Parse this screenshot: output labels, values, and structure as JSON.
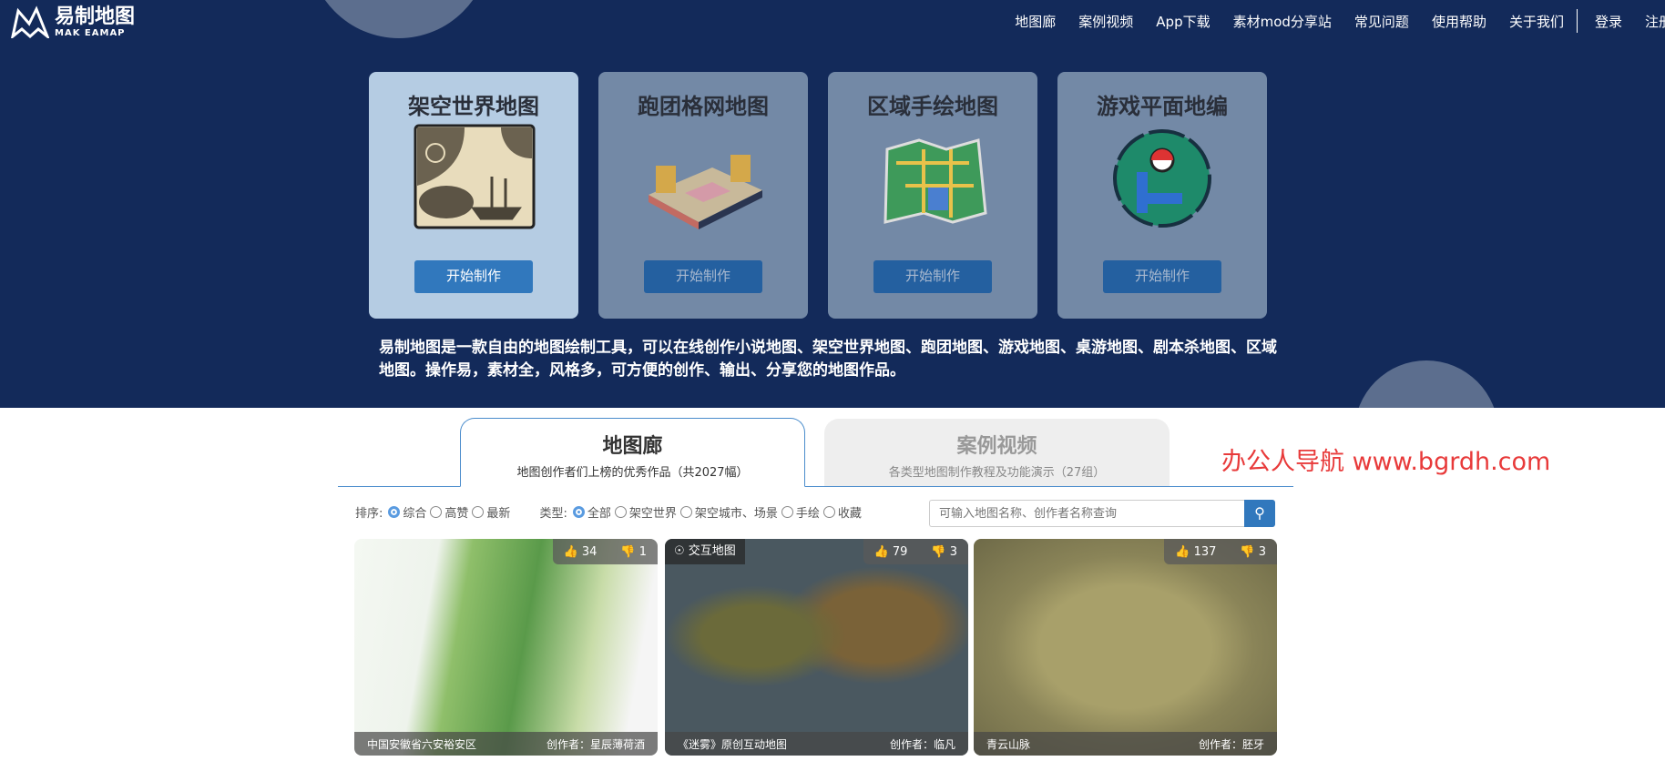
{
  "header": {
    "logo_cn": "易制地图",
    "logo_en": "MAK EAMAP",
    "nav": [
      "地图廊",
      "案例视频",
      "App下载",
      "素材mod分享站",
      "常见问题",
      "使用帮助",
      "关于我们"
    ],
    "login": "登录",
    "register": "注册"
  },
  "cards": [
    {
      "title": "架空世界地图",
      "button": "开始制作"
    },
    {
      "title": "跑团格网地图",
      "button": "开始制作"
    },
    {
      "title": "区域手绘地图",
      "button": "开始制作"
    },
    {
      "title": "游戏平面地编",
      "button": "开始制作"
    }
  ],
  "description": "易制地图是一款自由的地图绘制工具，可以在线创作小说地图、架空世界地图、跑团地图、游戏地图、桌游地图、剧本杀地图、区域地图。操作易，素材全，风格多，可方便的创作、输出、分享您的地图作品。",
  "tabs": [
    {
      "title": "地图廊",
      "subtitle": "地图创作者们上榜的优秀作品（共2027幅）"
    },
    {
      "title": "案例视频",
      "subtitle": "各类型地图制作教程及功能演示（27组）"
    }
  ],
  "watermark": "办公人导航 www.bgrdh.com",
  "filters": {
    "sort_label": "排序:",
    "sort": [
      "综合",
      "高赞",
      "最新"
    ],
    "sort_selected": "综合",
    "type_label": "类型:",
    "types": [
      "全部",
      "架空世界",
      "架空城市、场景",
      "手绘",
      "收藏"
    ],
    "type_selected": "全部"
  },
  "search": {
    "placeholder": "可输入地图名称、创作者名称查询"
  },
  "maps": [
    {
      "name": "中国安徽省六安裕安区",
      "author": "创作者：星辰薄荷酒",
      "likes": "34",
      "dislikes": "1",
      "badge": ""
    },
    {
      "name": "《迷雾》原创互动地图",
      "author": "创作者：临凡",
      "likes": "79",
      "dislikes": "3",
      "badge": "交互地图"
    },
    {
      "name": "青云山脉",
      "author": "创作者：胚牙",
      "likes": "137",
      "dislikes": "3",
      "badge": ""
    }
  ],
  "colors": {
    "hero_bg": "#132a5a",
    "card_active": "#b5cce3",
    "card": "#7389a6",
    "button": "#3178bd",
    "watermark": "#e83a3a"
  }
}
